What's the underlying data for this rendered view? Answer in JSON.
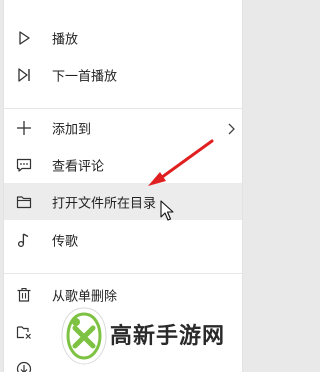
{
  "menu": {
    "items": [
      {
        "label": "播放",
        "icon": "play-icon"
      },
      {
        "label": "下一首播放",
        "icon": "next-track-icon"
      },
      {
        "label": "添加到",
        "icon": "plus-icon",
        "has_submenu": true
      },
      {
        "label": "查看评论",
        "icon": "comment-icon"
      },
      {
        "label": "打开文件所在目录",
        "icon": "folder-icon",
        "hovered": true
      },
      {
        "label": "传歌",
        "icon": "music-note-icon"
      },
      {
        "label": "从歌单删除",
        "icon": "trash-icon"
      }
    ]
  },
  "watermark": {
    "text": "高新手游网"
  },
  "colors": {
    "arrow": "#e02020",
    "hover_bg": "#ececec",
    "logo_green": "#7dc242"
  }
}
